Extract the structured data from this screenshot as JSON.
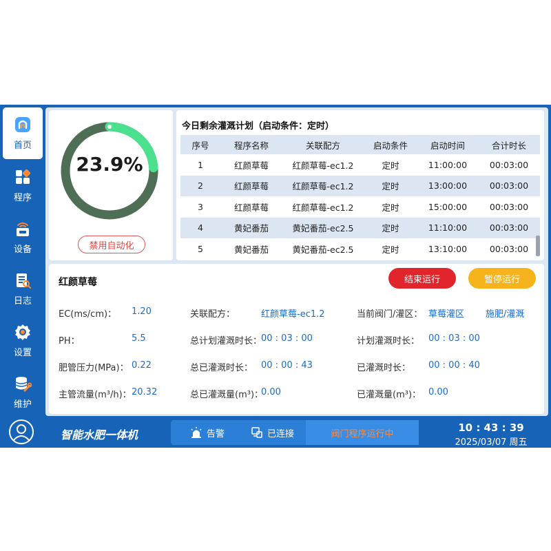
{
  "sidebar": {
    "items": [
      {
        "label": "首页",
        "icon": "home-icon"
      },
      {
        "label": "程序",
        "icon": "program-icon"
      },
      {
        "label": "设备",
        "icon": "device-icon"
      },
      {
        "label": "日志",
        "icon": "log-icon"
      },
      {
        "label": "设置",
        "icon": "settings-icon"
      },
      {
        "label": "维护",
        "icon": "maintenance-icon"
      }
    ]
  },
  "gauge": {
    "percent_text": "23.9%",
    "progress_fraction": 0.239,
    "disable_auto_label": "禁用自动化"
  },
  "plan": {
    "title": "今日剩余灌溉计划（启动条件：定时）",
    "headers": [
      "序号",
      "程序名称",
      "关联配方",
      "启动条件",
      "启动时间",
      "合计时长"
    ],
    "rows": [
      [
        "1",
        "红颜草莓",
        "红颜草莓-ec1.2",
        "定时",
        "11:00:00",
        "00:03:00"
      ],
      [
        "2",
        "红颜草莓",
        "红颜草莓-ec1.2",
        "定时",
        "13:00:00",
        "00:03:00"
      ],
      [
        "3",
        "红颜草莓",
        "红颜草莓-ec1.2",
        "定时",
        "15:00:00",
        "00:03:00"
      ],
      [
        "4",
        "黄妃番茄",
        "黄妃番茄-ec2.5",
        "定时",
        "11:10:00",
        "00:03:00"
      ],
      [
        "5",
        "黄妃番茄",
        "黄妃番茄-ec2.5",
        "定时",
        "13:10:00",
        "00:03:00"
      ]
    ]
  },
  "detail": {
    "title": "红颜草莓",
    "stop_label": "结束运行",
    "pause_label": "暂停运行",
    "ec_label": "EC(ms/cm)：",
    "ec_value": "1.20",
    "ph_label": "PH：",
    "ph_value": "5.5",
    "pressure_label": "肥管压力(MPa)：",
    "pressure_value": "0.22",
    "flow_label": "主管流量(m³/h)：",
    "flow_value": "20.32",
    "recipe_label": "关联配方：",
    "recipe_value": "红颜草莓-ec1.2",
    "plan_total_label": "总计划灌溉时长：",
    "plan_total_value": "00 : 03 : 00",
    "done_total_label": "总已灌溉时长：",
    "done_total_value": "00 : 00 : 43",
    "vol_total_label": "总已灌溉量(m³)：",
    "vol_total_value": "0.00",
    "valve_label": "当前阀门/灌区：",
    "valve_value": "草莓灌区",
    "valve_mode": "施肥/灌溉",
    "plan_label": "计划灌溉时长：",
    "plan_value": "00 : 03 : 00",
    "done_label": "已灌溉时长：",
    "done_value": "00 : 00 : 40",
    "vol_label": "已灌溉量(m³)：",
    "vol_value": "0.00"
  },
  "bottombar": {
    "brand": "智能水肥一体机",
    "alarm_label": "告警",
    "connection_label": "已连接",
    "run_status": "阀门程序运行中",
    "time": "10 : 43 : 39",
    "date": "2025/03/07  周五"
  },
  "colors": {
    "primary": "#1763b8",
    "gauge_track": "#4e6e55",
    "gauge_progress": "#4be08e",
    "stop": "#e0262c",
    "pause": "#f6b31b",
    "value_text": "#1a6bd0"
  }
}
